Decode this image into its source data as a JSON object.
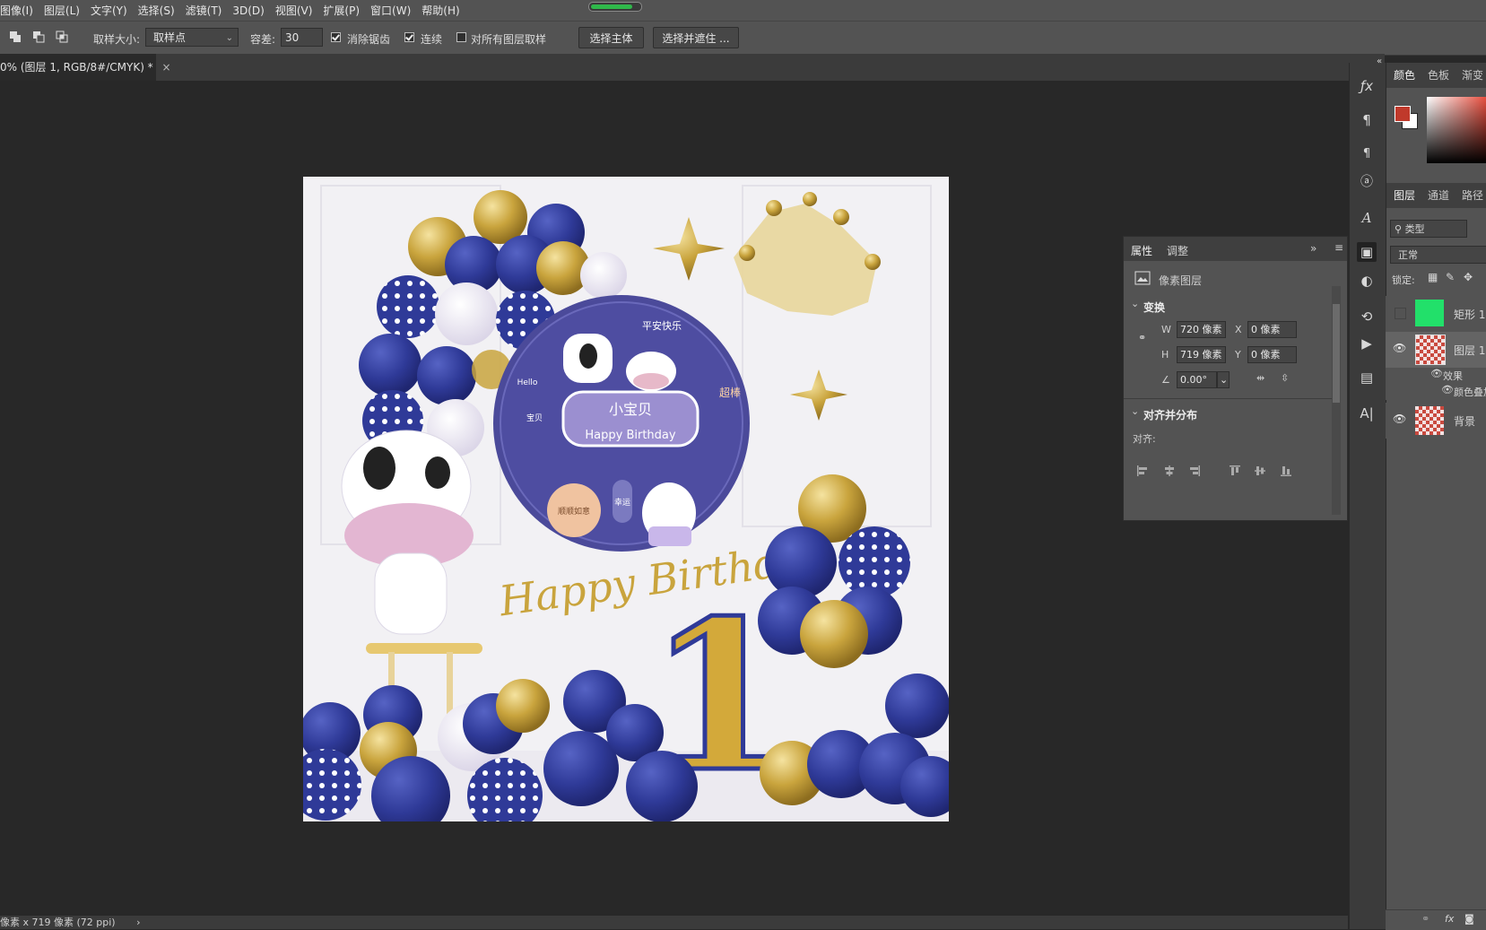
{
  "menu": {
    "items": [
      "图像(I)",
      "图层(L)",
      "文字(Y)",
      "选择(S)",
      "滤镜(T)",
      "3D(D)",
      "视图(V)",
      "扩展(P)",
      "窗口(W)",
      "帮助(H)"
    ],
    "progress_fraction": 0.85
  },
  "options": {
    "sample_size_label": "取样大小:",
    "sample_size_value": "取样点",
    "tolerance_label": "容差:",
    "tolerance_value": "30",
    "antialias_label": "消除锯齿",
    "antialias_checked": true,
    "contiguous_label": "连续",
    "contiguous_checked": true,
    "all_layers_label": "对所有图层取样",
    "all_layers_checked": false,
    "select_subject_label": "选择主体",
    "select_mask_label": "选择并遮住 ..."
  },
  "document": {
    "tab_title": "0% (图层 1, RGB/8#/CMYK) *",
    "close_glyph": "×"
  },
  "status": {
    "text": "像素 x 719 像素 (72 ppi)",
    "arrow": "›"
  },
  "artwork": {
    "badge_title": "小宝贝",
    "badge_subtitle": "Happy Birthday",
    "badge_top_text": "平安快乐",
    "badge_right_text": "超棒",
    "badge_tag_hello": "Hello",
    "badge_tag_left": "宝贝",
    "badge_fruit_text": "顺顺如意",
    "badge_side_text": "幸运",
    "banner_text": "Happy Birthday",
    "number": "1",
    "colors": {
      "navy": "#2e3a96",
      "gold": "#c9a43d",
      "badge": "#4b4a9a",
      "badge_inner": "#9b8fd0"
    }
  },
  "properties": {
    "tab_properties": "属性",
    "tab_adjust": "调整",
    "layer_type": "像素图层",
    "transform_title": "变换",
    "w_label": "W",
    "w_value": "720 像素",
    "h_label": "H",
    "h_value": "719 像素",
    "x_label": "X",
    "x_value": "0 像素",
    "y_label": "Y",
    "y_value": "0 像素",
    "angle_value": "0.00°",
    "align_title": "对齐并分布",
    "align_label": "对齐:"
  },
  "color_panel": {
    "tabs": [
      "颜色",
      "色板",
      "渐变"
    ],
    "foreground": "#c0392b",
    "background": "#ffffff"
  },
  "layers_panel": {
    "tabs": [
      "图层",
      "通道",
      "路径"
    ],
    "filter_label": "类型",
    "blend_mode": "正常",
    "lock_label": "锁定:",
    "layers": [
      {
        "name": "矩形 1",
        "visible": false,
        "thumb_color": "#22e06a"
      },
      {
        "name": "图层 1",
        "visible": true,
        "thumb_color": "#c94a3f"
      },
      {
        "name": "背景",
        "visible": true,
        "thumb_color": "#c94a3f"
      }
    ],
    "effects_label": "效果",
    "effect_item": "颜色叠加"
  },
  "tool_strip": {
    "icons": [
      "fx-icon",
      "paragraph-icon",
      "paragraph-style-icon",
      "character-style-icon",
      "glyphs-icon",
      "libraries-icon",
      "adjustments-icon",
      "history-icon",
      "actions-icon",
      "properties-icon",
      "text-icon"
    ]
  }
}
